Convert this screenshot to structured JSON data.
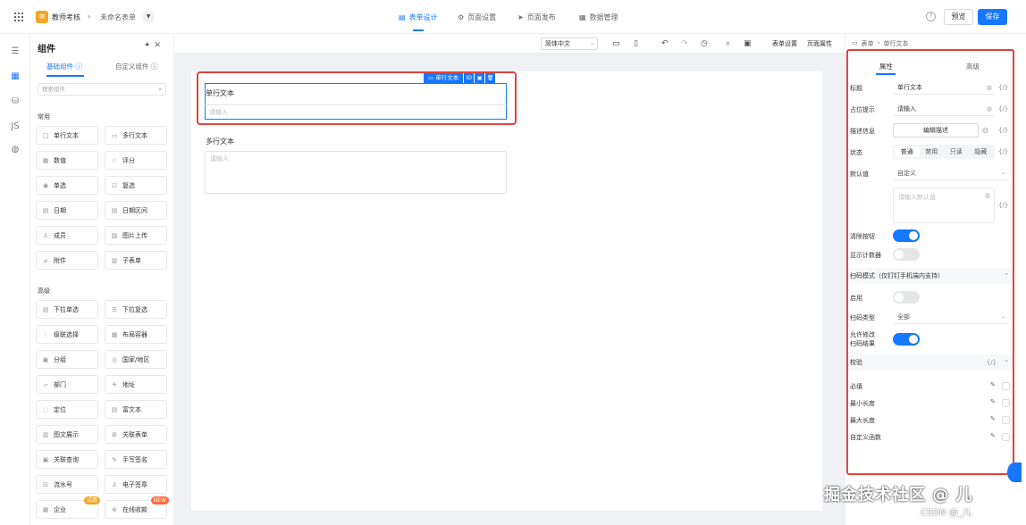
{
  "topbar": {
    "app_title": "教师考核",
    "form_name": "未命名表单",
    "tabs": [
      {
        "label": "表单设计",
        "icon": "form-design-icon"
      },
      {
        "label": "页面设置",
        "icon": "gear-icon"
      },
      {
        "label": "页面发布",
        "icon": "send-icon"
      },
      {
        "label": "数据管理",
        "icon": "table-icon"
      }
    ],
    "help": "?",
    "preview_label": "预览",
    "save_label": "保存"
  },
  "components_panel": {
    "title": "组件",
    "tabs": [
      "基础组件",
      "自定义组件"
    ],
    "search_placeholder": "搜索组件",
    "common_section": "常用",
    "common_items": [
      {
        "label": "单行文本",
        "icon": "□"
      },
      {
        "label": "多行文本",
        "icon": "▭"
      },
      {
        "label": "数值",
        "icon": "▦"
      },
      {
        "label": "评分",
        "icon": "☆"
      },
      {
        "label": "单选",
        "icon": "◉"
      },
      {
        "label": "复选",
        "icon": "☑"
      },
      {
        "label": "日期",
        "icon": "▤"
      },
      {
        "label": "日期区间",
        "icon": "▤"
      },
      {
        "label": "成员",
        "icon": "♙"
      },
      {
        "label": "图片上传",
        "icon": "▧"
      },
      {
        "label": "附件",
        "icon": "⌀"
      },
      {
        "label": "子表单",
        "icon": "▥"
      }
    ],
    "advanced_section": "高级",
    "advanced_items": [
      {
        "label": "下拉单选",
        "icon": "▤"
      },
      {
        "label": "下拉复选",
        "icon": "☰"
      },
      {
        "label": "级联选择",
        "icon": "⋮"
      },
      {
        "label": "布局容器",
        "icon": "▦"
      },
      {
        "label": "分组",
        "icon": "▣"
      },
      {
        "label": "国家/地区",
        "icon": "◎"
      },
      {
        "label": "部门",
        "icon": "▱"
      },
      {
        "label": "地址",
        "icon": "✈"
      },
      {
        "label": "定位",
        "icon": "◌"
      },
      {
        "label": "富文本",
        "icon": "▤"
      },
      {
        "label": "图文展示",
        "icon": "▥"
      },
      {
        "label": "关联表单",
        "icon": "⊞"
      },
      {
        "label": "关联查询",
        "icon": "▣"
      },
      {
        "label": "手写签名",
        "icon": "✎"
      },
      {
        "label": "流水号",
        "icon": "⊟"
      },
      {
        "label": "电子签章",
        "icon": "♙"
      },
      {
        "label": "企业",
        "icon": "▦",
        "badge": "试用",
        "badge_color": "#f5a623"
      },
      {
        "label": "在线收款",
        "icon": "⊛",
        "badge": "NEW",
        "badge_color": "#ff6a3d"
      }
    ]
  },
  "toolbar": {
    "font_select": "简体中文",
    "form_settings": "表单设置",
    "page_props": "页面属性"
  },
  "canvas": {
    "selected_tag": "单行文本",
    "selected_id": "ID",
    "field1_label": "单行文本",
    "field1_placeholder": "请输入",
    "field2_label": "多行文本",
    "field2_placeholder": "请输入"
  },
  "props_panel": {
    "breadcrumb_form": "表单",
    "breadcrumb_field": "单行文本",
    "tab_props": "属性",
    "tab_advanced": "高级",
    "title_label": "标题",
    "title_value": "单行文本",
    "placeholder_label": "占位提示",
    "placeholder_value": "请输入",
    "desc_label": "描述信息",
    "desc_button": "编辑描述",
    "state_label": "状态",
    "state_options": [
      "普通",
      "禁用",
      "只读",
      "隐藏"
    ],
    "default_label": "默认值",
    "default_select": "自定义",
    "default_placeholder": "请输入默认值",
    "clear_label": "清除按钮",
    "clear_on": true,
    "counter_label": "显示计数器",
    "counter_on": false,
    "scan_section": "扫码模式（仅钉钉手机端内支持）",
    "enable_label": "启用",
    "enable_on": false,
    "scan_type_label": "扫码类型",
    "scan_type_value": "全部",
    "allow_edit_label_1": "允许修改",
    "allow_edit_label_2": "扫码结果",
    "allow_edit_on": true,
    "validate_section": "校验",
    "validate_fx": "{/}",
    "validations": [
      "必填",
      "最小长度",
      "最大长度",
      "自定义函数"
    ],
    "fx": "{/}"
  },
  "watermark": {
    "main": "掘金技术社区 @ 儿",
    "sub": "CSDN @_儿"
  }
}
